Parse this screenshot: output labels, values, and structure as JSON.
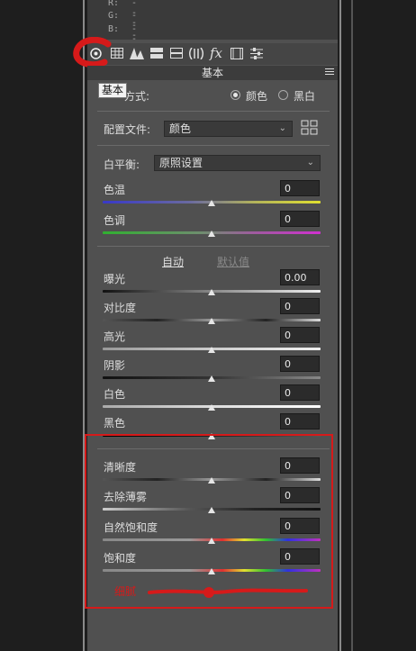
{
  "info": {
    "rows": [
      {
        "label": "R:",
        "value": "---"
      },
      {
        "label": "G:",
        "value": "---"
      },
      {
        "label": "B:",
        "value": "---"
      }
    ]
  },
  "tabs": [
    {
      "name": "basic-tab",
      "icon": "aperture-icon"
    },
    {
      "name": "tone-curve-tab",
      "icon": "grid-icon"
    },
    {
      "name": "detail-tab",
      "icon": "triangles-icon"
    },
    {
      "name": "hsl-tab",
      "icon": "hsl-grid-icon"
    },
    {
      "name": "split-toning-tab",
      "icon": "split-icon"
    },
    {
      "name": "lens-tab",
      "icon": "lens-icon"
    },
    {
      "name": "effects-tab",
      "icon": "fx-icon"
    },
    {
      "name": "calibration-tab",
      "icon": "film-icon"
    },
    {
      "name": "presets-tab",
      "icon": "sliders-icon"
    }
  ],
  "section": {
    "title": "基本"
  },
  "tooltip": "基本",
  "treatment": {
    "label_suffix": "方式:",
    "options": [
      "颜色",
      "黑白"
    ],
    "selected": "颜色"
  },
  "profile": {
    "label": "配置文件:",
    "value": "颜色"
  },
  "white_balance": {
    "label": "白平衡:",
    "value": "原照设置"
  },
  "sliders_wb": [
    {
      "name": "temperature",
      "label": "色温",
      "value": "0",
      "level": 0.5
    },
    {
      "name": "tint",
      "label": "色调",
      "value": "0",
      "level": 0.5
    }
  ],
  "auto_links": {
    "auto": "自动",
    "default": "默认值"
  },
  "sliders_tone": [
    {
      "name": "exposure",
      "label": "曝光",
      "value": "0.00",
      "level": 0.5
    },
    {
      "name": "contrast",
      "label": "对比度",
      "value": "0",
      "level": 0.5
    },
    {
      "name": "highlights",
      "label": "高光",
      "value": "0",
      "level": 0.5
    },
    {
      "name": "shadows",
      "label": "阴影",
      "value": "0",
      "level": 0.5
    },
    {
      "name": "whites",
      "label": "白色",
      "value": "0",
      "level": 0.5
    },
    {
      "name": "blacks",
      "label": "黑色",
      "value": "0",
      "level": 0.5
    }
  ],
  "sliders_presence": [
    {
      "name": "clarity",
      "label": "清晰度",
      "value": "0",
      "level": 0.5
    },
    {
      "name": "dehaze",
      "label": "去除薄雾",
      "value": "0",
      "level": 0.5
    },
    {
      "name": "vibrance",
      "label": "自然饱和度",
      "value": "0",
      "level": 0.5
    },
    {
      "name": "saturation",
      "label": "饱和度",
      "value": "0",
      "level": 0.5
    }
  ],
  "annotation": {
    "text": "细腻"
  },
  "colors": {
    "panel": "#505050",
    "annotation_red": "#d61a1a"
  }
}
